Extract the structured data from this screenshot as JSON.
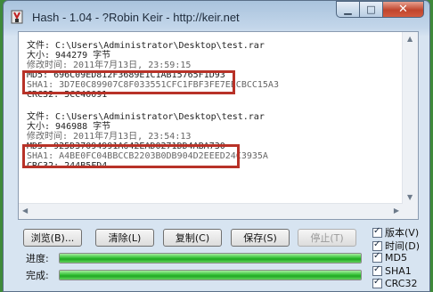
{
  "window": {
    "title": "Hash - 1.04 - ?Robin Keir - http://keir.net"
  },
  "colors": {
    "highlight": "#b83228",
    "progress": "#2fb62f"
  },
  "output": {
    "file1": [
      "文件: C:\\Users\\Administrator\\Desktop\\test.rar",
      "大小: 944279 字节",
      "修改时间: 2011年7月13日, 23:59:15",
      "MD5: 696C09ED812F3689E1C1AB15765F1D93",
      "SHA1: 3D7E0C89907C8F033551CFC1FBF3FE7EECBCC15A3",
      "CRC32: 5CC40091"
    ],
    "file2": [
      "文件: C:\\Users\\Administrator\\Desktop\\test.rar",
      "大小: 946988 字节",
      "修改时间: 2011年7月13日, 23:54:13",
      "MD5: 925D37094991A642EAD0271DD4ABA730",
      "SHA1: A4BE0FC04BBCCB2203B0DB904D2EEED24C3935A",
      "CRC32: 244B5FD4"
    ]
  },
  "buttons": {
    "browse": "浏览(B)...",
    "clear": "清除(L)",
    "copy": "复制(C)",
    "save": "保存(S)",
    "stop": "停止(T)"
  },
  "progress": {
    "label1": "进度:",
    "label2": "完成:",
    "value1": 1.0,
    "value2": 1.0
  },
  "options": [
    {
      "label": "版本(V)",
      "checked": true
    },
    {
      "label": "时间(D)",
      "checked": true
    },
    {
      "label": "MD5",
      "checked": true
    },
    {
      "label": "SHA1",
      "checked": true
    },
    {
      "label": "CRC32",
      "checked": true
    }
  ]
}
